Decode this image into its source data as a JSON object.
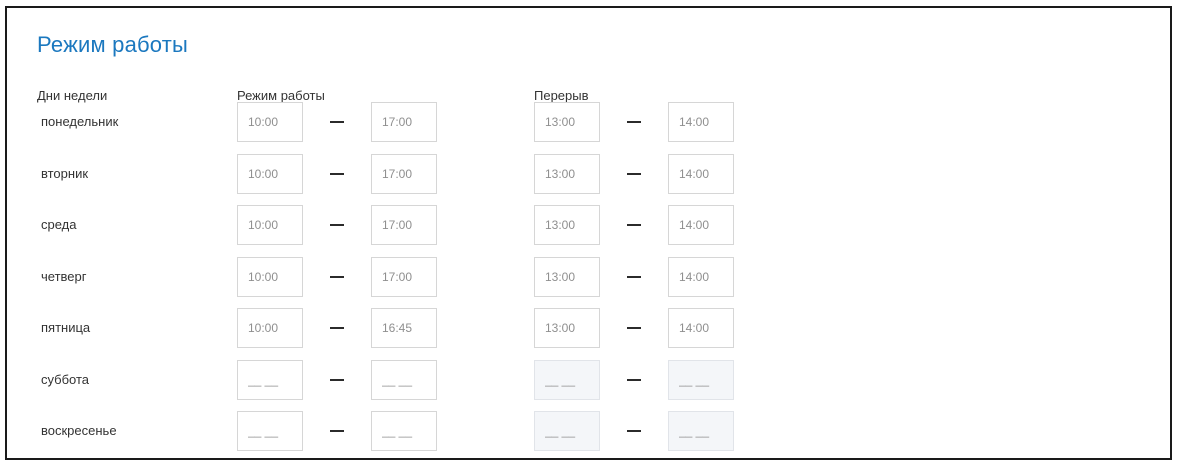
{
  "section_title": "Режим работы",
  "headers": {
    "days": "Дни недели",
    "work": "Режим работы",
    "break": "Перерыв"
  },
  "rows": [
    {
      "day": "понедельник",
      "work_from": "10:00",
      "work_to": "17:00",
      "break_from": "13:00",
      "break_to": "14:00",
      "break_disabled": false
    },
    {
      "day": "вторник",
      "work_from": "10:00",
      "work_to": "17:00",
      "break_from": "13:00",
      "break_to": "14:00",
      "break_disabled": false
    },
    {
      "day": "среда",
      "work_from": "10:00",
      "work_to": "17:00",
      "break_from": "13:00",
      "break_to": "14:00",
      "break_disabled": false
    },
    {
      "day": "четверг",
      "work_from": "10:00",
      "work_to": "17:00",
      "break_from": "13:00",
      "break_to": "14:00",
      "break_disabled": false
    },
    {
      "day": "пятница",
      "work_from": "10:00",
      "work_to": "16:45",
      "break_from": "13:00",
      "break_to": "14:00",
      "break_disabled": false
    },
    {
      "day": "суббота",
      "work_from": "__ __",
      "work_to": "__ __",
      "break_from": "__ __",
      "break_to": "__ __",
      "break_disabled": true
    },
    {
      "day": "воскресенье",
      "work_from": "__ __",
      "work_to": "__ __",
      "break_from": "__ __",
      "break_to": "__ __",
      "break_disabled": true
    }
  ]
}
